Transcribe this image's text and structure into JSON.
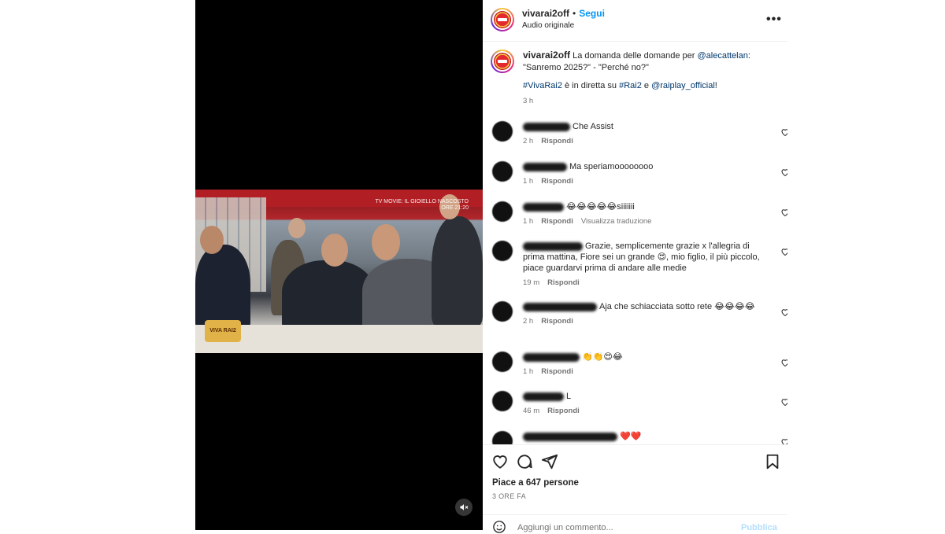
{
  "header": {
    "username": "vivarai2off",
    "separator": "•",
    "follow_label": "Segui",
    "subtitle": "Audio originale",
    "more_label": "•••"
  },
  "caption": {
    "username": "vivarai2off",
    "text_1": " La domanda delle domande per ",
    "mention_1": "@alecattelan",
    "text_2": ": \"Sanremo 2025?\" - \"Perché no?\"",
    "hashtag_1": "#VivaRai2",
    "text_3": " è in diretta su ",
    "hashtag_2": "#Rai2",
    "text_4": " e ",
    "mention_2": "@raiplay_official",
    "text_5": "!",
    "time": "3 h"
  },
  "video": {
    "overlay_line1": "TV MOVIE: IL GIOIELLO NASCOSTO",
    "overlay_line2": "ORE 21:20",
    "sticker_text": "VIVA RAI2"
  },
  "comments": [
    {
      "text": "Che Assist",
      "time": "2 h",
      "reply": "Rispondi",
      "extra": ""
    },
    {
      "text": "Ma speriamoooooooo",
      "time": "1 h",
      "reply": "Rispondi",
      "extra": ""
    },
    {
      "text": "😂😂😂😂😂siiiiiii",
      "time": "1 h",
      "reply": "Rispondi",
      "extra": "Visualizza traduzione"
    },
    {
      "text": "Grazie, semplicemente grazie x l'allegria di prima mattina, Fiore sei un grande 😍, mio figlio, il più piccolo, piace guardarvi prima di andare alle medie",
      "time": "19 m",
      "reply": "Rispondi",
      "extra": ""
    },
    {
      "text": "Aja che schiacciata sotto rete 😂😂😂😂",
      "time": "2 h",
      "reply": "Rispondi",
      "extra": ""
    },
    {
      "text": "👏👏😍😂",
      "time": "1 h",
      "reply": "Rispondi",
      "extra": ""
    },
    {
      "text": "L",
      "time": "46 m",
      "reply": "Rispondi",
      "extra": ""
    },
    {
      "text": "❤️❤️",
      "time": "",
      "reply": "",
      "extra": ""
    }
  ],
  "actions": {
    "likes": "Piace a 647 persone",
    "posted": "3 ORE FA",
    "add_comment_placeholder": "Aggiungi un commento...",
    "publish_label": "Pubblica"
  }
}
